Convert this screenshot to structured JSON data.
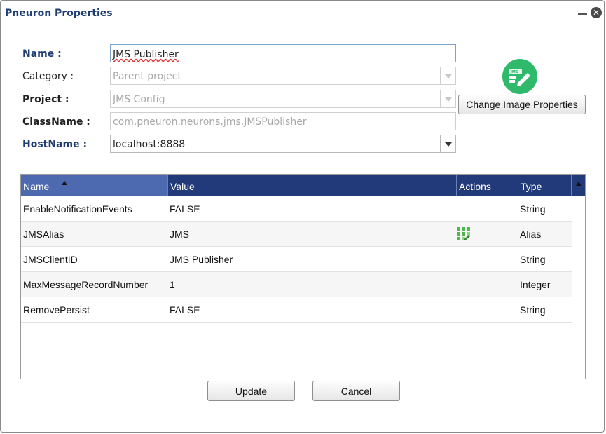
{
  "window": {
    "title": "Pneuron Properties",
    "close_glyph": "✕"
  },
  "form": {
    "name_label": "Name :",
    "name_value": "JMS Publisher",
    "category_label": "Category :",
    "category_value": "Parent project",
    "project_label": "Project :",
    "project_value": "JMS Config",
    "classname_label": "ClassName :",
    "classname_value": "com.pneuron.neurons.jms.JMSPublisher",
    "hostname_label": "HostName :",
    "hostname_value": "localhost:8888"
  },
  "image": {
    "icon": "jms-icon",
    "icon_text": "JMS",
    "color": "#2fb96b",
    "button_label": "Change Image Properties"
  },
  "grid": {
    "columns": [
      "Name",
      "Value",
      "Actions",
      "Type"
    ],
    "sorted_column": "Name",
    "sort_direction": "ascending",
    "header_color": "#223a7a",
    "rows": [
      {
        "name": "EnableNotificationEvents",
        "value": "FALSE",
        "action_icon": "",
        "type": "String"
      },
      {
        "name": "JMSAlias",
        "value": "JMS",
        "action_icon": "grid-edit-icon",
        "type": "Alias"
      },
      {
        "name": "JMSClientID",
        "value": "JMS Publisher",
        "action_icon": "",
        "type": "String"
      },
      {
        "name": "MaxMessageRecordNumber",
        "value": "1",
        "action_icon": "",
        "type": "Integer"
      },
      {
        "name": "RemovePersist",
        "value": "FALSE",
        "action_icon": "",
        "type": "String"
      }
    ]
  },
  "footer": {
    "update_label": "Update",
    "cancel_label": "Cancel"
  }
}
